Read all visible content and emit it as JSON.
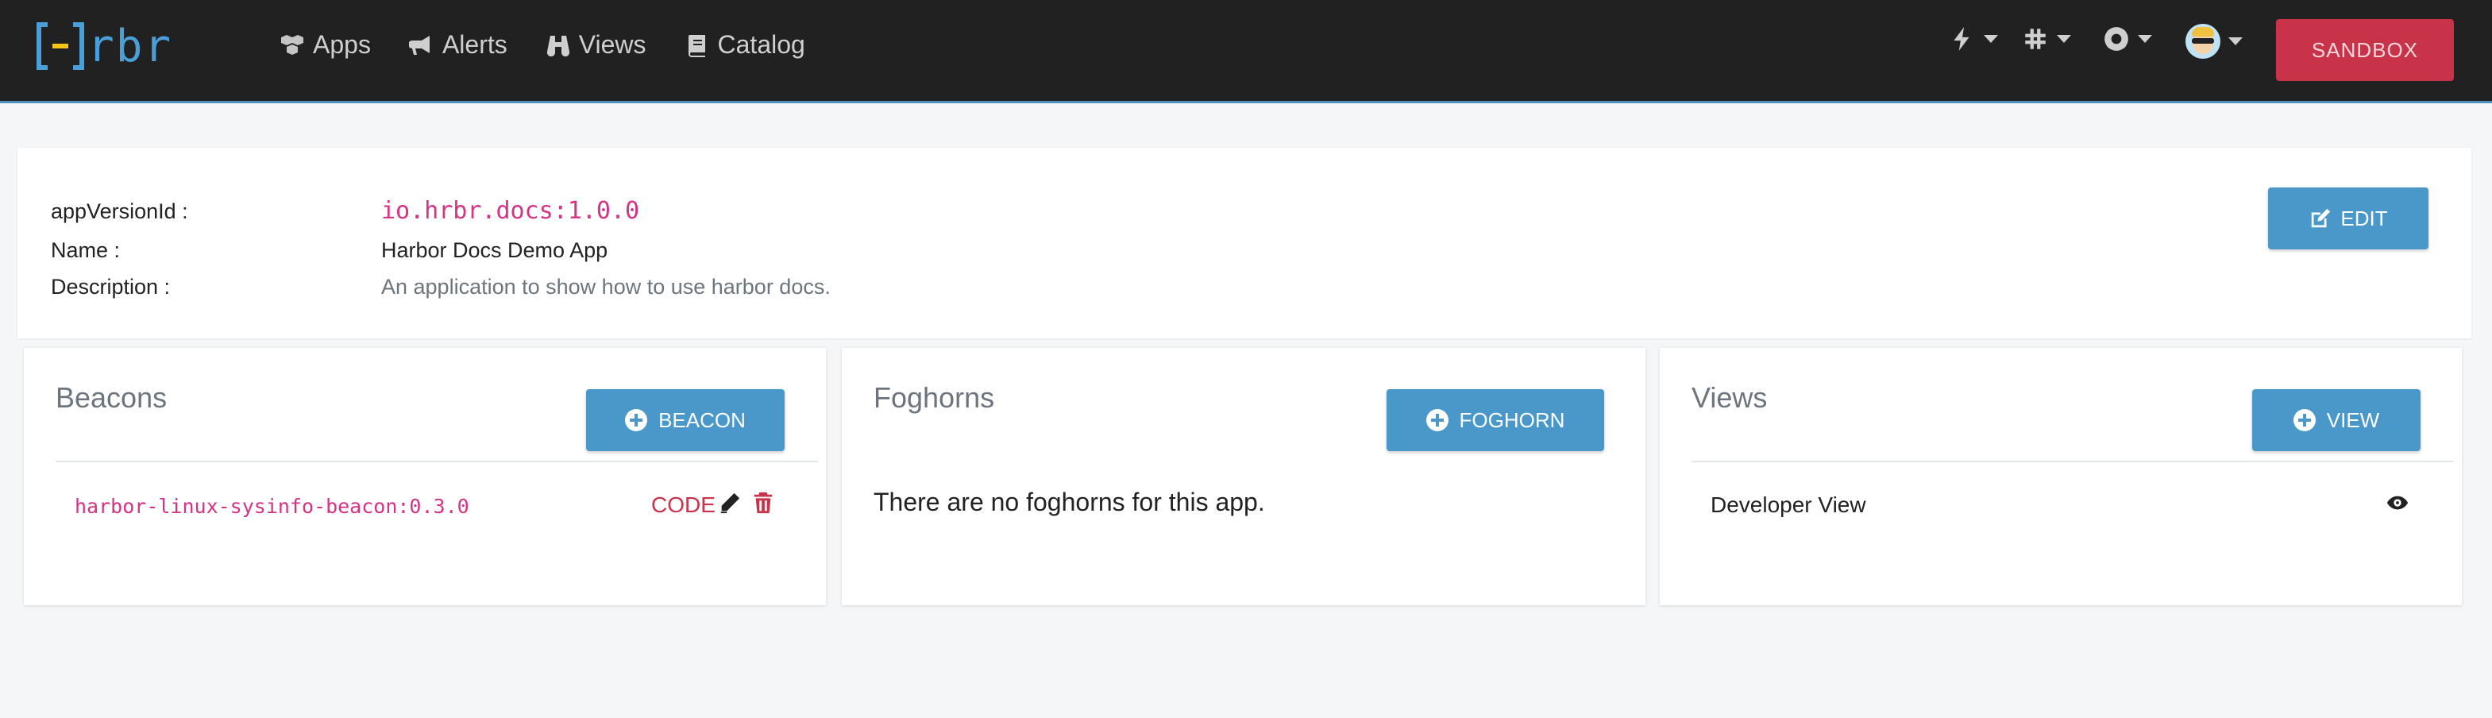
{
  "navbar": {
    "logo_text": "rbr",
    "links": [
      {
        "label": "Apps",
        "icon": "cubes-icon"
      },
      {
        "label": "Alerts",
        "icon": "bullhorn-icon"
      },
      {
        "label": "Views",
        "icon": "binoculars-icon"
      },
      {
        "label": "Catalog",
        "icon": "book-icon"
      }
    ],
    "dropdowns": [
      "bolt-icon",
      "slack-icon",
      "life-ring-icon",
      "avatar"
    ],
    "sandbox_label": "SANDBOX"
  },
  "app_info": {
    "rows": [
      {
        "label": "appVersionId :",
        "value": "io.hrbr.docs:1.0.0"
      },
      {
        "label": "Name :",
        "value": "Harbor Docs Demo App"
      },
      {
        "label": "Description :",
        "value": "An application to show how to use harbor docs."
      }
    ],
    "edit_label": "EDIT"
  },
  "beacons": {
    "title": "Beacons",
    "add_label": "BEACON",
    "items": [
      {
        "name": "harbor-linux-sysinfo-beacon:0.3.0",
        "code_label": "CODE"
      }
    ]
  },
  "foghorns": {
    "title": "Foghorns",
    "add_label": "FOGHORN",
    "empty_message": "There are no foghorns for this app."
  },
  "views": {
    "title": "Views",
    "add_label": "VIEW",
    "items": [
      {
        "name": "Developer View"
      }
    ]
  },
  "colors": {
    "navbar_bg": "#212121",
    "primary": "#4a98c9",
    "danger": "#c9334a",
    "code_pink": "#d63384"
  }
}
